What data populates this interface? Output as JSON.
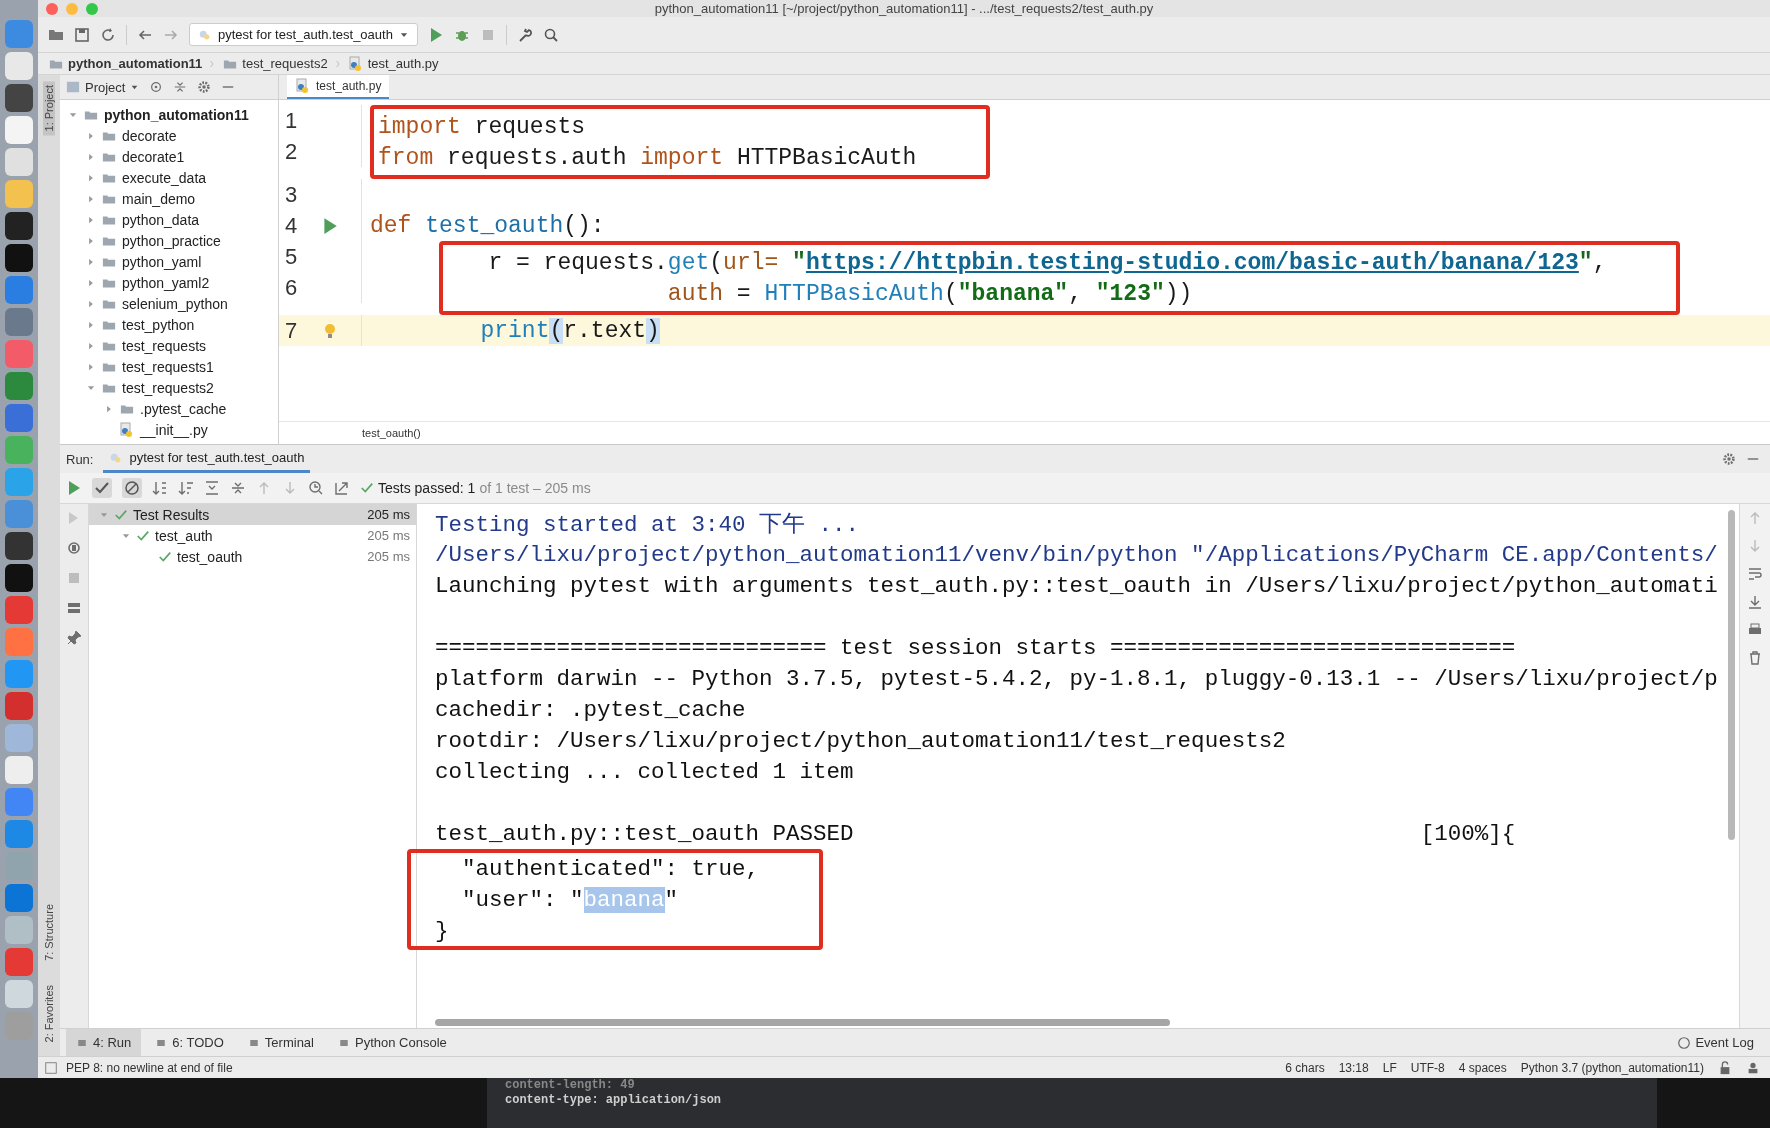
{
  "window": {
    "title": "python_automation11 [~/project/python_automation11] - .../test_requests2/test_auth.py"
  },
  "toolbar": {
    "run_config": "pytest for test_auth.test_oauth"
  },
  "breadcrumbs": [
    "python_automation11",
    "test_requests2",
    "test_auth.py"
  ],
  "side_strip": {
    "top": [
      {
        "label": "1: Project",
        "selected": true
      }
    ],
    "bottom": [
      {
        "label": "7: Structure",
        "selected": false
      },
      {
        "label": "2: Favorites",
        "selected": false
      }
    ]
  },
  "project_panel": {
    "title": "Project",
    "tree": [
      {
        "label": "python_automation11",
        "kind": "folder",
        "expanded": true,
        "children": [
          {
            "label": "decorate",
            "kind": "folder",
            "expanded": false
          },
          {
            "label": "decorate1",
            "kind": "folder",
            "expanded": false
          },
          {
            "label": "execute_data",
            "kind": "folder",
            "expanded": false
          },
          {
            "label": "main_demo",
            "kind": "folder",
            "expanded": false
          },
          {
            "label": "python_data",
            "kind": "folder",
            "expanded": false
          },
          {
            "label": "python_practice",
            "kind": "folder",
            "expanded": false
          },
          {
            "label": "python_yaml",
            "kind": "folder",
            "expanded": false
          },
          {
            "label": "python_yaml2",
            "kind": "folder",
            "expanded": false
          },
          {
            "label": "selenium_python",
            "kind": "folder",
            "expanded": false
          },
          {
            "label": "test_python",
            "kind": "folder",
            "expanded": false
          },
          {
            "label": "test_requests",
            "kind": "folder",
            "expanded": false
          },
          {
            "label": "test_requests1",
            "kind": "folder",
            "expanded": false
          },
          {
            "label": "test_requests2",
            "kind": "folder",
            "expanded": true,
            "children": [
              {
                "label": ".pytest_cache",
                "kind": "folder",
                "expanded": false
              },
              {
                "label": "__init__.py",
                "kind": "file"
              }
            ]
          }
        ]
      }
    ]
  },
  "editor": {
    "tabs": [
      {
        "label": "test_auth.py",
        "selected": true
      }
    ],
    "lines": [
      {
        "number": "1",
        "highlighted": true,
        "current": false,
        "tokens": [
          {
            "text": "import",
            "kind": "keyword"
          },
          {
            "text": " requests",
            "kind": "plain"
          }
        ]
      },
      {
        "number": "2",
        "highlighted": true,
        "current": false,
        "tokens": [
          {
            "text": "from",
            "kind": "keyword"
          },
          {
            "text": " requests.auth ",
            "kind": "plain"
          },
          {
            "text": "import",
            "kind": "keyword"
          },
          {
            "text": " HTTPBasicAuth",
            "kind": "plain"
          }
        ]
      },
      {
        "number": "3",
        "highlighted": false,
        "current": false
      },
      {
        "number": "4",
        "highlighted": false,
        "current": false,
        "gutter": {
          "kind": "run"
        },
        "tokens": [
          {
            "text": "def",
            "kind": "keyword"
          },
          {
            "text": " test_oauth",
            "kind": "function"
          },
          {
            "text": "():",
            "kind": "plain"
          }
        ]
      },
      {
        "number": "5",
        "highlighted": true,
        "current": false,
        "tokens": [
          {
            "text": "        r = requests.",
            "kind": "plain"
          },
          {
            "text": "get",
            "kind": "call"
          },
          {
            "text": "(",
            "kind": "plain"
          },
          {
            "text": "url=",
            "kind": "param"
          },
          {
            "text": " \"",
            "kind": "string"
          },
          {
            "text": "https://httpbin.testing-studio.com/basic-auth/banana/123",
            "kind": "link"
          },
          {
            "text": "\"",
            "kind": "string"
          },
          {
            "text": ",",
            "kind": "plain"
          }
        ]
      },
      {
        "number": "6",
        "highlighted": true,
        "current": false,
        "tokens": [
          {
            "text": "                     auth",
            "kind": "param"
          },
          {
            "text": " = ",
            "kind": "plain"
          },
          {
            "text": "HTTPBasicAuth",
            "kind": "call"
          },
          {
            "text": "(",
            "kind": "plain"
          },
          {
            "text": "\"banana\"",
            "kind": "string"
          },
          {
            "text": ", ",
            "kind": "plain"
          },
          {
            "text": "\"123\"",
            "kind": "string"
          },
          {
            "text": "))",
            "kind": "plain"
          }
        ]
      },
      {
        "number": "7",
        "highlighted": false,
        "current": true,
        "gutter": {
          "kind": "bulb"
        },
        "tokens": [
          {
            "text": "        print",
            "kind": "call"
          },
          {
            "text": "(",
            "kind": "bracket"
          },
          {
            "text": "r.text",
            "kind": "plain"
          },
          {
            "text": ")",
            "kind": "bracket"
          }
        ]
      }
    ],
    "breadcrumb": "test_oauth()"
  },
  "run_panel": {
    "label": "Run:",
    "tabs": [
      {
        "label": "pytest for test_auth.test_oauth",
        "selected": true
      }
    ],
    "status": {
      "label": "Tests passed:",
      "count": "1",
      "detail": "of 1 test – 205 ms"
    },
    "tree": [
      {
        "label": "Test Results",
        "time": "205 ms",
        "selected": true,
        "expanded": true,
        "children": [
          {
            "label": "test_auth",
            "time": "205 ms",
            "selected": false,
            "expanded": true,
            "children": [
              {
                "label": "test_oauth",
                "time": "205 ms",
                "selected": false
              }
            ]
          }
        ]
      }
    ],
    "console": [
      {
        "kind": "info",
        "highlighted": false,
        "segments": [
          {
            "text": "Testing started at 3:40 下午 ...",
            "selected": false
          }
        ]
      },
      {
        "kind": "info",
        "highlighted": false,
        "segments": [
          {
            "text": "/Users/lixu/project/python_automation11/venv/bin/python \"/Applications/PyCharm CE.app/Contents/",
            "selected": false
          }
        ]
      },
      {
        "kind": "plain",
        "highlighted": false,
        "segments": [
          {
            "text": "Launching pytest with arguments test_auth.py::test_oauth in /Users/lixu/project/python_automati",
            "selected": false
          }
        ]
      },
      {
        "kind": "blank",
        "highlighted": false
      },
      {
        "kind": "plain",
        "highlighted": false,
        "segments": [
          {
            "text": "============================= test session starts ==============================",
            "selected": false
          }
        ]
      },
      {
        "kind": "plain",
        "highlighted": false,
        "segments": [
          {
            "text": "platform darwin -- Python 3.7.5, pytest-5.4.2, py-1.8.1, pluggy-0.13.1 -- /Users/lixu/project/p",
            "selected": false
          }
        ]
      },
      {
        "kind": "plain",
        "highlighted": false,
        "segments": [
          {
            "text": "cachedir: .pytest_cache",
            "selected": false
          }
        ]
      },
      {
        "kind": "plain",
        "highlighted": false,
        "segments": [
          {
            "text": "rootdir: /Users/lixu/project/python_automation11/test_requests2",
            "selected": false
          }
        ]
      },
      {
        "kind": "plain",
        "highlighted": false,
        "segments": [
          {
            "text": "collecting ... collected 1 item",
            "selected": false
          }
        ]
      },
      {
        "kind": "blank",
        "highlighted": false
      },
      {
        "kind": "plain",
        "highlighted": false,
        "segments": [
          {
            "text": "test_auth.py::test_oauth PASSED                                          [100%]{",
            "selected": false
          }
        ]
      },
      {
        "kind": "plain",
        "highlighted": true,
        "segments": [
          {
            "text": "  \"authenticated\": true,",
            "selected": false
          }
        ]
      },
      {
        "kind": "plain",
        "highlighted": true,
        "segments": [
          {
            "text": "  \"user\": \"",
            "selected": false
          },
          {
            "text": "banana",
            "selected": true
          },
          {
            "text": "\"",
            "selected": false
          }
        ]
      },
      {
        "kind": "plain",
        "highlighted": true,
        "segments": [
          {
            "text": "}",
            "selected": false
          }
        ]
      }
    ]
  },
  "tool_tabs": [
    {
      "label": "4: Run",
      "selected": true
    },
    {
      "label": "6: TODO",
      "selected": false
    },
    {
      "label": "Terminal",
      "selected": false
    },
    {
      "label": "Python Console",
      "selected": false
    }
  ],
  "event_log": "Event Log",
  "status_bar": {
    "message": "PEP 8: no newline at end of file",
    "items": [
      "6 chars",
      "13:18",
      "LF",
      "UTF-8",
      "4 spaces",
      "Python 3.7 (python_automation11)"
    ]
  },
  "background_terminal": [
    "content-length: 49",
    "content-type: application/json"
  ]
}
